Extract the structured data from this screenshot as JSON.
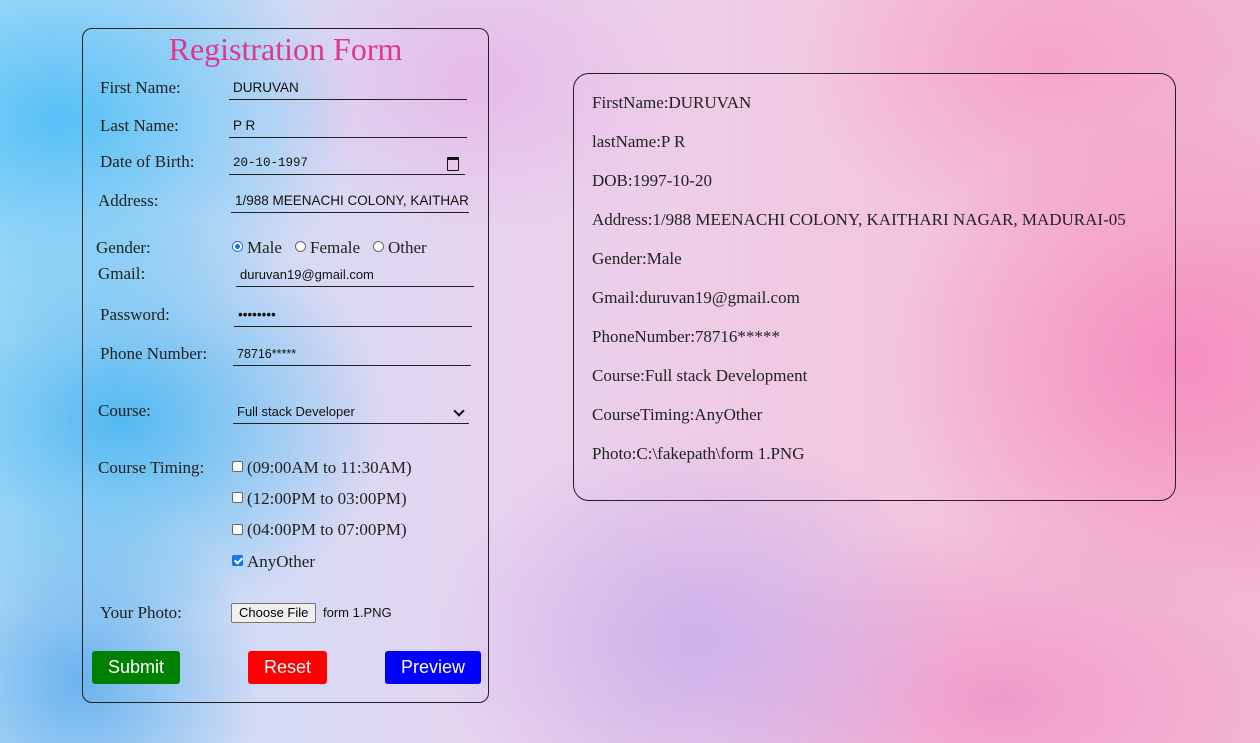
{
  "form": {
    "title": "Registration Form",
    "first_name_label": "First Name:",
    "first_name_value": "DURUVAN",
    "last_name_label": "Last Name:",
    "last_name_value": "P R",
    "dob_label": "Date of Birth:",
    "dob_value": "20-10-1997",
    "address_label": "Address:",
    "address_value": "1/988 MEENACHI COLONY, KAITHARI",
    "gender_label": "Gender:",
    "gender_options": [
      "Male",
      "Female",
      "Other"
    ],
    "gender_selected": "Male",
    "gmail_label": "Gmail:",
    "gmail_value": "duruvan19@gmail.com",
    "password_label": "Password:",
    "password_value": "••••••••",
    "phone_label": "Phone Number:",
    "phone_value": "78716*****",
    "course_label": "Course:",
    "course_value": "Full stack Developer",
    "timing_label": "Course Timing:",
    "timing_options": [
      {
        "label": "(09:00AM to 11:30AM)",
        "checked": false
      },
      {
        "label": "(12:00PM to 03:00PM)",
        "checked": false
      },
      {
        "label": "(04:00PM to 07:00PM)",
        "checked": false
      },
      {
        "label": "AnyOther",
        "checked": true
      }
    ],
    "photo_label": "Your Photo:",
    "choose_file_label": "Choose File",
    "file_name": "form 1.PNG",
    "submit_label": "Submit",
    "reset_label": "Reset",
    "preview_label": "Preview"
  },
  "preview": {
    "lines": [
      "FirstName:DURUVAN",
      "lastName:P R",
      "DOB:1997-10-20",
      "Address:1/988 MEENACHI COLONY, KAITHARI NAGAR, MADURAI-05",
      "Gender:Male",
      "Gmail:duruvan19@gmail.com",
      "PhoneNumber:78716*****",
      "Course:Full stack Development",
      "CourseTiming:AnyOther",
      "Photo:C:\\fakepath\\form 1.PNG"
    ]
  },
  "colors": {
    "title": "#e0368e",
    "submit": "#008000",
    "reset": "#ff0000",
    "preview": "#0000ff",
    "checked": "#1a73e8"
  }
}
